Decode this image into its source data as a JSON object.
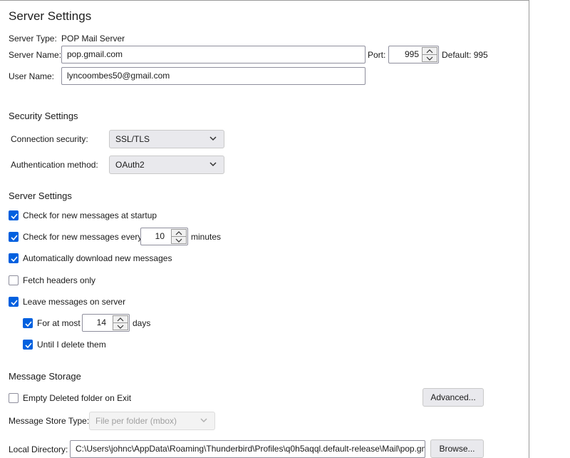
{
  "page": {
    "title": "Server Settings"
  },
  "server": {
    "type_label": "Server Type:",
    "type_value": "POP Mail Server",
    "name_label": "Server Name:",
    "name_value": "pop.gmail.com",
    "port_label": "Port:",
    "port_value": "995",
    "default_label": "Default: 995",
    "user_label": "User Name:",
    "user_value": "lyncoombes50@gmail.com"
  },
  "security": {
    "title": "Security Settings",
    "connection_label": "Connection security:",
    "connection_value": "SSL/TLS",
    "auth_label": "Authentication method:",
    "auth_value": "OAuth2"
  },
  "settings": {
    "title": "Server Settings",
    "check_startup": {
      "label": "Check for new messages at startup",
      "checked": true
    },
    "check_every": {
      "label": "Check for new messages every",
      "value": "10",
      "suffix": "minutes",
      "checked": true
    },
    "auto_download": {
      "label": "Automatically download new messages",
      "checked": true
    },
    "fetch_headers": {
      "label": "Fetch headers only",
      "checked": false
    },
    "leave_on_server": {
      "label": "Leave messages on server",
      "checked": true
    },
    "for_at_most": {
      "label": "For at most",
      "value": "14",
      "suffix": "days",
      "checked": true
    },
    "until_delete": {
      "label": "Until I delete them",
      "checked": true
    }
  },
  "storage": {
    "title": "Message Storage",
    "empty_deleted": {
      "label": "Empty Deleted folder on Exit",
      "checked": false
    },
    "advanced_label": "Advanced...",
    "store_type_label": "Message Store Type:",
    "store_type_value": "File per folder (mbox)",
    "local_dir_label": "Local Directory:",
    "local_dir_value": "C:\\Users\\johnc\\AppData\\Roaming\\Thunderbird\\Profiles\\q0h5aqql.default-release\\Mail\\pop.gmail.com",
    "browse_label": "Browse..."
  },
  "colors": {
    "accent": "#0060df",
    "border": "#8f8f9d",
    "button_bg": "#e9e9ed"
  }
}
